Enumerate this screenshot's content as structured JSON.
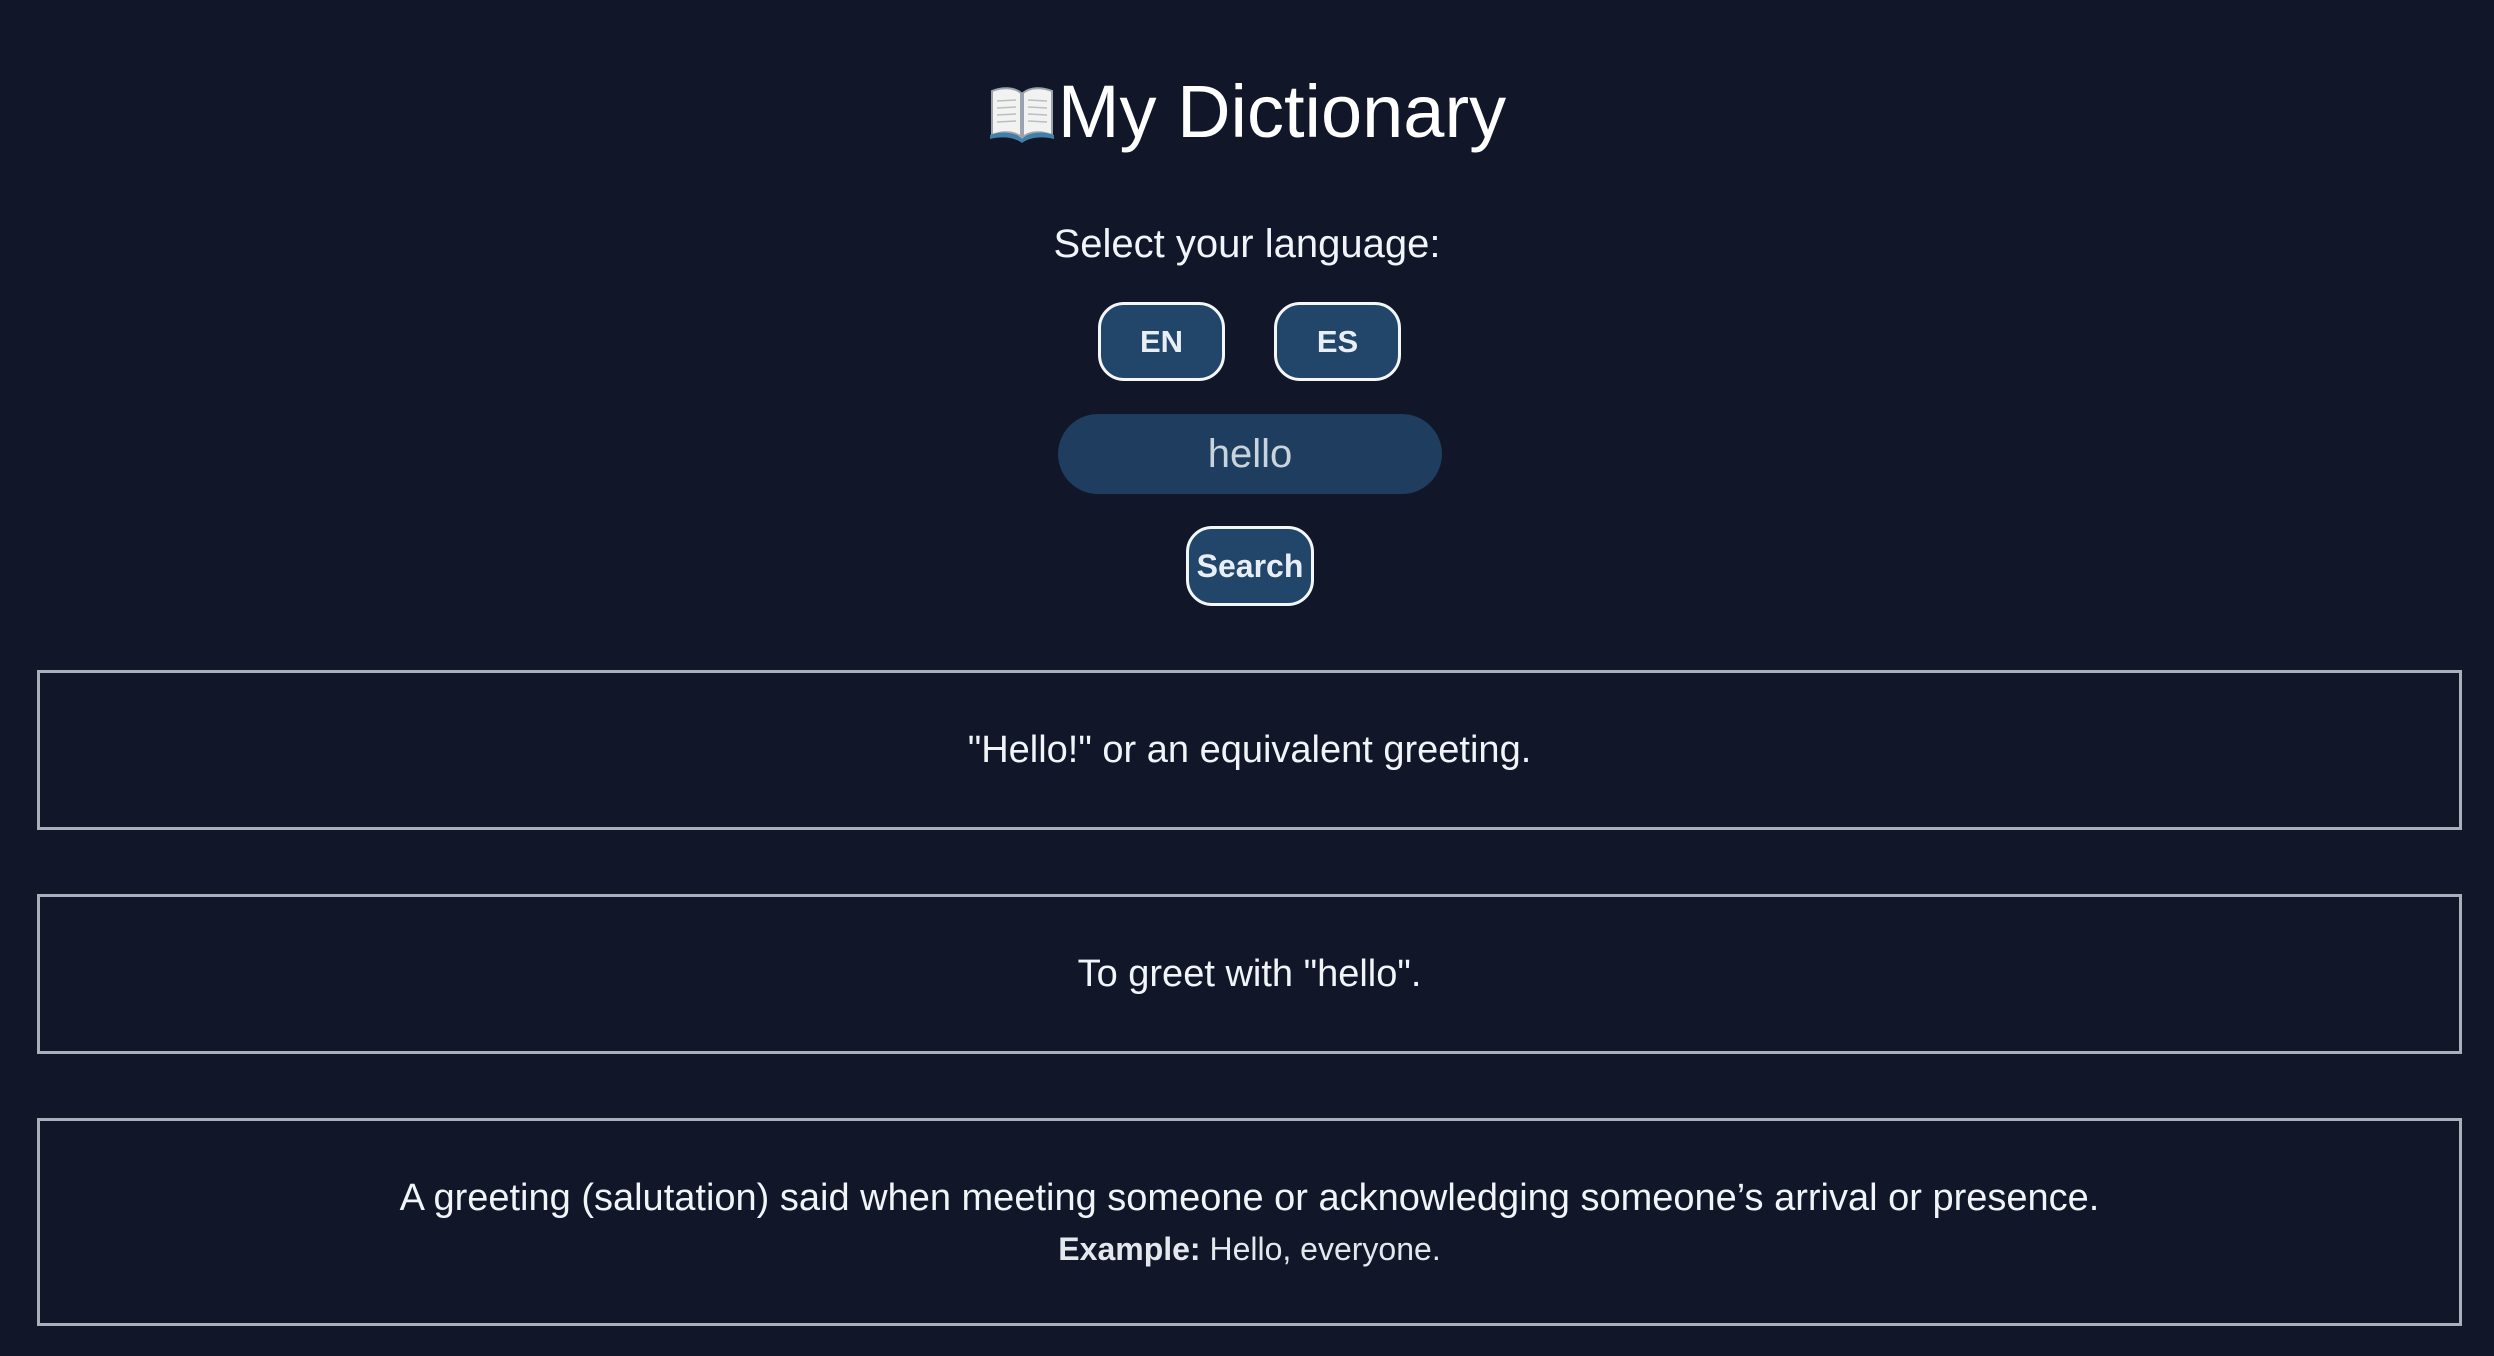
{
  "header": {
    "icon": "open-book-icon",
    "title": "My Dictionary"
  },
  "language": {
    "label": "Select your language:",
    "options": [
      {
        "label": "EN"
      },
      {
        "label": "ES"
      }
    ]
  },
  "search": {
    "value": "hello",
    "button_label": "Search"
  },
  "results": [
    {
      "definition": "\"Hello!\" or an equivalent greeting."
    },
    {
      "definition": "To greet with \"hello\"."
    },
    {
      "definition": "A greeting (salutation) said when meeting someone or acknowledging someone’s arrival or presence.",
      "example_label": "Example:",
      "example_text": "Hello, everyone."
    }
  ],
  "colors": {
    "background": "#111729",
    "button": "#22466a",
    "input": "#1f3d5e",
    "card_border": "#a9b0bb"
  }
}
